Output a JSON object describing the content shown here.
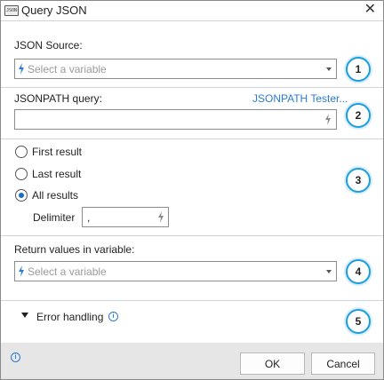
{
  "window": {
    "title": "Query JSON",
    "app_icon_text": "JSON"
  },
  "json_source": {
    "label": "JSON Source:",
    "placeholder": "Select a variable",
    "step": "1"
  },
  "jsonpath": {
    "label": "JSONPATH query:",
    "tester_link": "JSONPATH Tester...",
    "value": "",
    "step": "2"
  },
  "results": {
    "options": [
      {
        "label": "First result",
        "checked": false
      },
      {
        "label": "Last result",
        "checked": false
      },
      {
        "label": "All results",
        "checked": true
      }
    ],
    "delimiter_label": "Delimiter",
    "delimiter_value": ",",
    "step": "3"
  },
  "return_values": {
    "label": "Return values in variable:",
    "placeholder": "Select a variable",
    "step": "4"
  },
  "error_handling": {
    "label": "Error handling",
    "step": "5"
  },
  "footer": {
    "ok_label": "OK",
    "cancel_label": "Cancel"
  },
  "colors": {
    "accent": "#1b9ee0",
    "link": "#2b7cd3",
    "footer_bg": "#e6e6e6"
  }
}
